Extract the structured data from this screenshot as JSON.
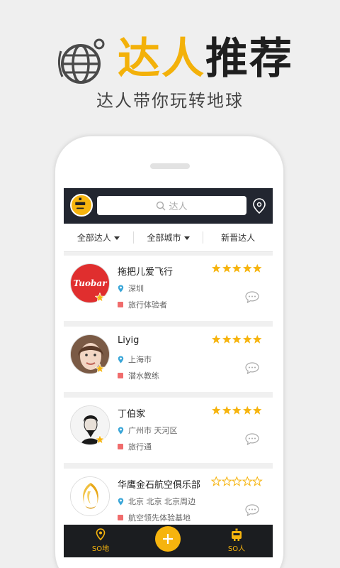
{
  "promo": {
    "title_accent": "达人",
    "title_rest": "推荐",
    "subtitle": "达人带你玩转地球"
  },
  "search": {
    "placeholder": "达人"
  },
  "filters": [
    "全部达人",
    "全部城市",
    "新晋达人"
  ],
  "experts": [
    {
      "name": "拖把儿爱飞行",
      "city": "深圳",
      "tag": "旅行体验者",
      "rating": 5,
      "avatar_text": "Tuobar"
    },
    {
      "name": "Liyig",
      "city": "上海市",
      "tag": "潜水教练",
      "rating": 5
    },
    {
      "name": "丁伯家",
      "city": "广州市 天河区",
      "tag": "旅行通",
      "rating": 5
    },
    {
      "name": "华鹰金石航空俱乐部",
      "city": "北京 北京 北京周边",
      "tag": "航空领先体验基地",
      "rating": 0
    }
  ],
  "tabs": {
    "left": "SO地",
    "right": "SO人"
  },
  "colors": {
    "accent": "#f6b40e",
    "bar": "#222630",
    "star": "#f6b40e"
  }
}
